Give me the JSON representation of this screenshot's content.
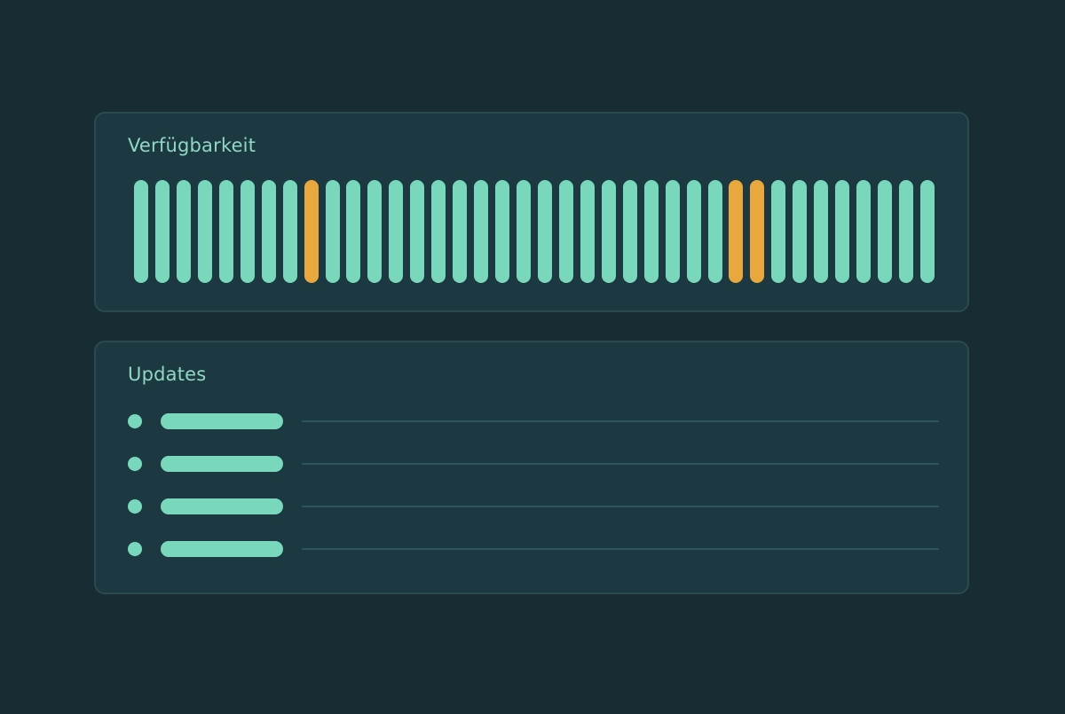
{
  "colors": {
    "background": "#172d33",
    "card": "#1c3840",
    "card_border": "#2a4a50",
    "title": "#8fd8c4",
    "status_ok": "#79d8bc",
    "status_degraded": "#e8a83e",
    "rule": "#2f555b"
  },
  "availability": {
    "title": "Verfügbarkeit",
    "statuses": [
      "ok",
      "ok",
      "ok",
      "ok",
      "ok",
      "ok",
      "ok",
      "ok",
      "degraded",
      "ok",
      "ok",
      "ok",
      "ok",
      "ok",
      "ok",
      "ok",
      "ok",
      "ok",
      "ok",
      "ok",
      "ok",
      "ok",
      "ok",
      "ok",
      "ok",
      "ok",
      "ok",
      "ok",
      "degraded",
      "degraded",
      "ok",
      "ok",
      "ok",
      "ok",
      "ok",
      "ok",
      "ok",
      "ok"
    ]
  },
  "updates": {
    "title": "Updates",
    "item_count": 4
  }
}
